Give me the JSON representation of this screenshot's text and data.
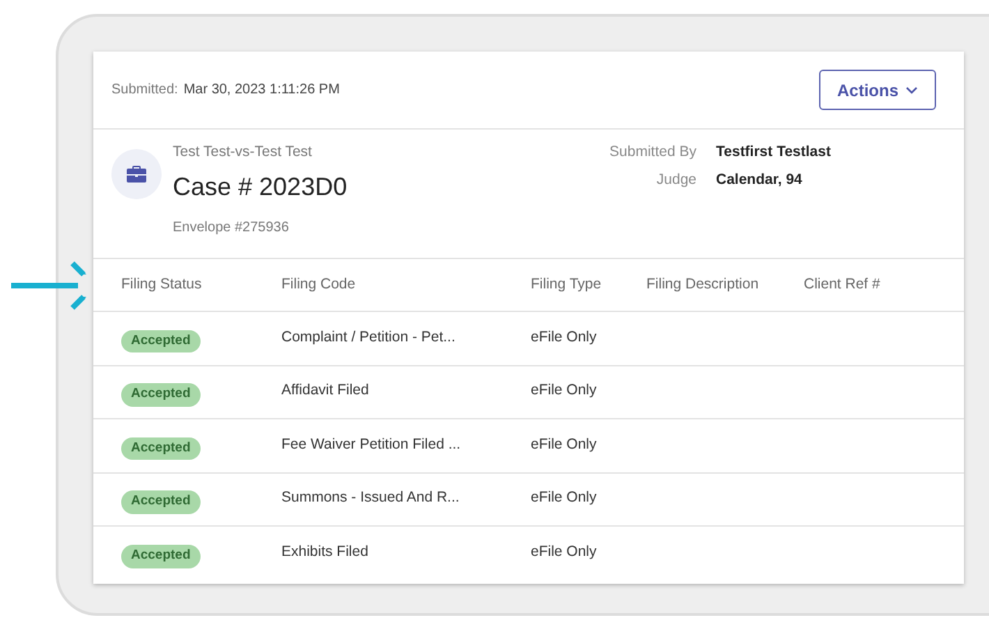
{
  "submitted": {
    "label": "Submitted:",
    "value": "Mar 30, 2023 1:11:26 PM"
  },
  "actions_button": {
    "label": "Actions"
  },
  "case": {
    "parties": "Test Test-vs-Test Test",
    "number": "Case # 2023D0",
    "envelope": "Envelope #275936"
  },
  "details": [
    {
      "label": "Submitted By",
      "value": "Testfirst Testlast"
    },
    {
      "label": "Judge",
      "value": "Calendar, 94"
    }
  ],
  "table": {
    "columns": [
      "Filing Status",
      "Filing Code",
      "Filing Type",
      "Filing Description",
      "Client Ref #"
    ],
    "rows": [
      {
        "status": "Accepted",
        "code": "Complaint / Petition - Pet...",
        "type": "eFile Only"
      },
      {
        "status": "Accepted",
        "code": "Affidavit Filed",
        "type": "eFile Only"
      },
      {
        "status": "Accepted",
        "code": "Fee Waiver Petition Filed ...",
        "type": "eFile Only"
      },
      {
        "status": "Accepted",
        "code": "Summons - Issued And R...",
        "type": "eFile Only"
      },
      {
        "status": "Accepted",
        "code": "Exhibits Filed",
        "type": "eFile Only"
      }
    ]
  }
}
